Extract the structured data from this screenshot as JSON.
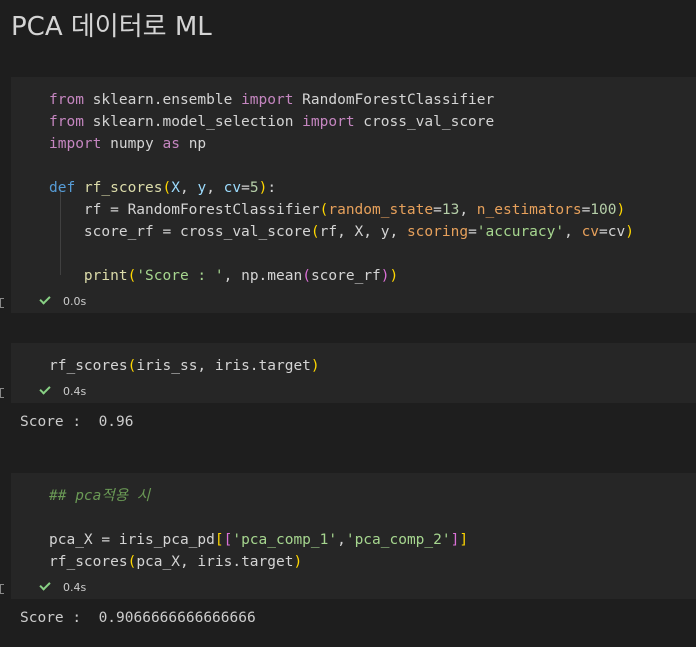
{
  "page_title": "PCA 데이터로 ML",
  "cells": [
    {
      "lines": [
        [
          [
            "kw",
            "from"
          ],
          [
            "plain",
            " sklearn.ensemble "
          ],
          [
            "kw",
            "import"
          ],
          [
            "plain",
            " RandomForestClassifier"
          ]
        ],
        [
          [
            "kw",
            "from"
          ],
          [
            "plain",
            " sklearn.model_selection "
          ],
          [
            "kw",
            "import"
          ],
          [
            "plain",
            " cross_val_score"
          ]
        ],
        [
          [
            "kw",
            "import"
          ],
          [
            "plain",
            " numpy "
          ],
          [
            "kw",
            "as"
          ],
          [
            "plain",
            " np"
          ]
        ],
        [],
        [
          [
            "kw-def",
            "def"
          ],
          [
            "plain",
            " "
          ],
          [
            "fn",
            "rf_scores"
          ],
          [
            "paren",
            "("
          ],
          [
            "param",
            "X"
          ],
          [
            "plain",
            ", "
          ],
          [
            "param",
            "y"
          ],
          [
            "plain",
            ", "
          ],
          [
            "param",
            "cv"
          ],
          [
            "plain",
            "="
          ],
          [
            "num",
            "5"
          ],
          [
            "paren",
            ")"
          ],
          [
            "plain",
            ":"
          ]
        ],
        [
          [
            "plain",
            "    rf = RandomForestClassifier"
          ],
          [
            "paren",
            "("
          ],
          [
            "param-orange",
            "random_state"
          ],
          [
            "plain",
            "="
          ],
          [
            "num",
            "13"
          ],
          [
            "plain",
            ", "
          ],
          [
            "param-orange",
            "n_estimators"
          ],
          [
            "plain",
            "="
          ],
          [
            "num",
            "100"
          ],
          [
            "paren",
            ")"
          ]
        ],
        [
          [
            "plain",
            "    score_rf = cross_val_score"
          ],
          [
            "paren",
            "("
          ],
          [
            "plain",
            "rf, X, y, "
          ],
          [
            "param-orange",
            "scoring"
          ],
          [
            "plain",
            "="
          ],
          [
            "str-green",
            "'accuracy'"
          ],
          [
            "plain",
            ", "
          ],
          [
            "param-orange",
            "cv"
          ],
          [
            "plain",
            "=cv"
          ],
          [
            "paren",
            ")"
          ]
        ],
        [],
        [
          [
            "plain",
            "    "
          ],
          [
            "fn",
            "print"
          ],
          [
            "paren",
            "("
          ],
          [
            "str-green",
            "'Score : '"
          ],
          [
            "plain",
            ", np.mean"
          ],
          [
            "paren2",
            "("
          ],
          [
            "plain",
            "score_rf"
          ],
          [
            "paren2",
            ")"
          ],
          [
            "paren",
            ")"
          ]
        ]
      ],
      "duration": "0.0s",
      "output": ""
    },
    {
      "lines": [
        [
          [
            "plain",
            "rf_scores"
          ],
          [
            "paren",
            "("
          ],
          [
            "plain",
            "iris_ss, iris.target"
          ],
          [
            "paren",
            ")"
          ]
        ]
      ],
      "duration": "0.4s",
      "output": "Score :  0.96"
    },
    {
      "lines": [
        [
          [
            "comment",
            "## pca적용 시"
          ]
        ],
        [],
        [
          [
            "plain",
            "pca_X = iris_pca_pd"
          ],
          [
            "paren",
            "["
          ],
          [
            "paren2",
            "["
          ],
          [
            "str-green",
            "'pca_comp_1'"
          ],
          [
            "plain",
            ","
          ],
          [
            "str-green",
            "'pca_comp_2'"
          ],
          [
            "paren2",
            "]"
          ],
          [
            "paren",
            "]"
          ]
        ],
        [
          [
            "plain",
            "rf_scores"
          ],
          [
            "paren",
            "("
          ],
          [
            "plain",
            "pca_X, iris.target"
          ],
          [
            "paren",
            ")"
          ]
        ]
      ],
      "duration": "0.4s",
      "output": "Score :  0.9066666666666666"
    }
  ]
}
